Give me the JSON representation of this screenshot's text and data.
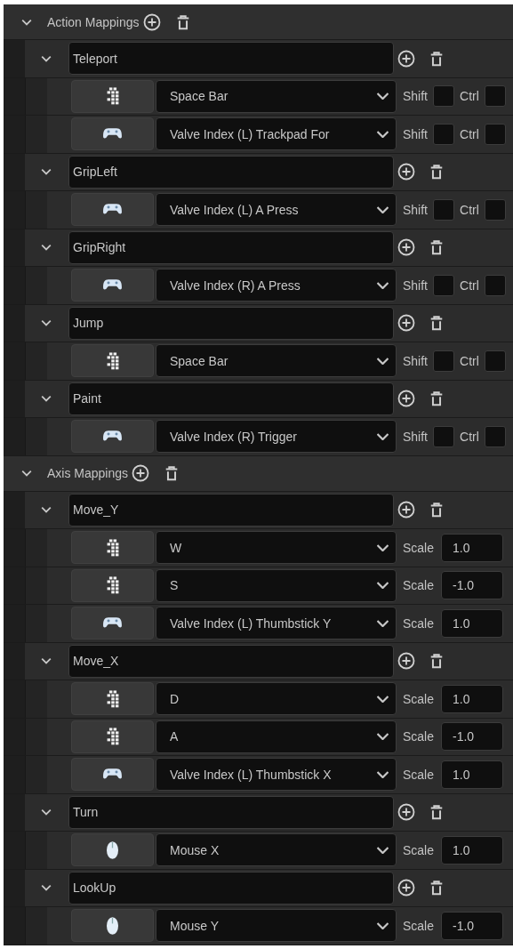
{
  "sections": [
    {
      "kind": "action",
      "title": "Action Mappings",
      "expanded": true,
      "mappings": [
        {
          "name": "Teleport",
          "expanded": true,
          "bindings": [
            {
              "kind": "keyboard",
              "key": "Space Bar",
              "modifiers": [
                {
                  "label": "Shift",
                  "checked": false
                },
                {
                  "label": "Ctrl",
                  "checked": false
                }
              ]
            },
            {
              "kind": "gamepad",
              "key": "Valve Index (L) Trackpad For",
              "modifiers": [
                {
                  "label": "Shift",
                  "checked": false
                },
                {
                  "label": "Ctrl",
                  "checked": false
                }
              ]
            }
          ]
        },
        {
          "name": "GripLeft",
          "expanded": true,
          "bindings": [
            {
              "kind": "gamepad",
              "key": "Valve Index (L) A Press",
              "modifiers": [
                {
                  "label": "Shift",
                  "checked": false
                },
                {
                  "label": "Ctrl",
                  "checked": false
                }
              ]
            }
          ]
        },
        {
          "name": "GripRight",
          "expanded": true,
          "bindings": [
            {
              "kind": "gamepad",
              "key": "Valve Index (R) A Press",
              "modifiers": [
                {
                  "label": "Shift",
                  "checked": false
                },
                {
                  "label": "Ctrl",
                  "checked": false
                }
              ]
            }
          ]
        },
        {
          "name": "Jump",
          "expanded": true,
          "bindings": [
            {
              "kind": "keyboard",
              "key": "Space Bar",
              "modifiers": [
                {
                  "label": "Shift",
                  "checked": false
                },
                {
                  "label": "Ctrl",
                  "checked": false
                }
              ]
            }
          ]
        },
        {
          "name": "Paint",
          "expanded": true,
          "bindings": [
            {
              "kind": "gamepad",
              "key": "Valve Index (R) Trigger",
              "modifiers": [
                {
                  "label": "Shift",
                  "checked": false
                },
                {
                  "label": "Ctrl",
                  "checked": false
                }
              ]
            }
          ]
        }
      ]
    },
    {
      "kind": "axis",
      "title": "Axis Mappings",
      "expanded": true,
      "mappings": [
        {
          "name": "Move_Y",
          "expanded": true,
          "bindings": [
            {
              "kind": "keyboard",
              "key": "W",
              "scale_label": "Scale",
              "scale": "1.0"
            },
            {
              "kind": "keyboard",
              "key": "S",
              "scale_label": "Scale",
              "scale": "-1.0"
            },
            {
              "kind": "gamepad",
              "key": "Valve Index (L) Thumbstick Y",
              "scale_label": "Scale",
              "scale": "1.0"
            }
          ]
        },
        {
          "name": "Move_X",
          "expanded": true,
          "bindings": [
            {
              "kind": "keyboard",
              "key": "D",
              "scale_label": "Scale",
              "scale": "1.0"
            },
            {
              "kind": "keyboard",
              "key": "A",
              "scale_label": "Scale",
              "scale": "-1.0"
            },
            {
              "kind": "gamepad",
              "key": "Valve Index (L) Thumbstick X",
              "scale_label": "Scale",
              "scale": "1.0"
            }
          ]
        },
        {
          "name": "Turn",
          "expanded": true,
          "bindings": [
            {
              "kind": "mouse",
              "key": "Mouse X",
              "scale_label": "Scale",
              "scale": "1.0"
            }
          ]
        },
        {
          "name": "LookUp",
          "expanded": true,
          "bindings": [
            {
              "kind": "mouse",
              "key": "Mouse Y",
              "scale_label": "Scale",
              "scale": "-1.0"
            }
          ]
        }
      ]
    }
  ]
}
